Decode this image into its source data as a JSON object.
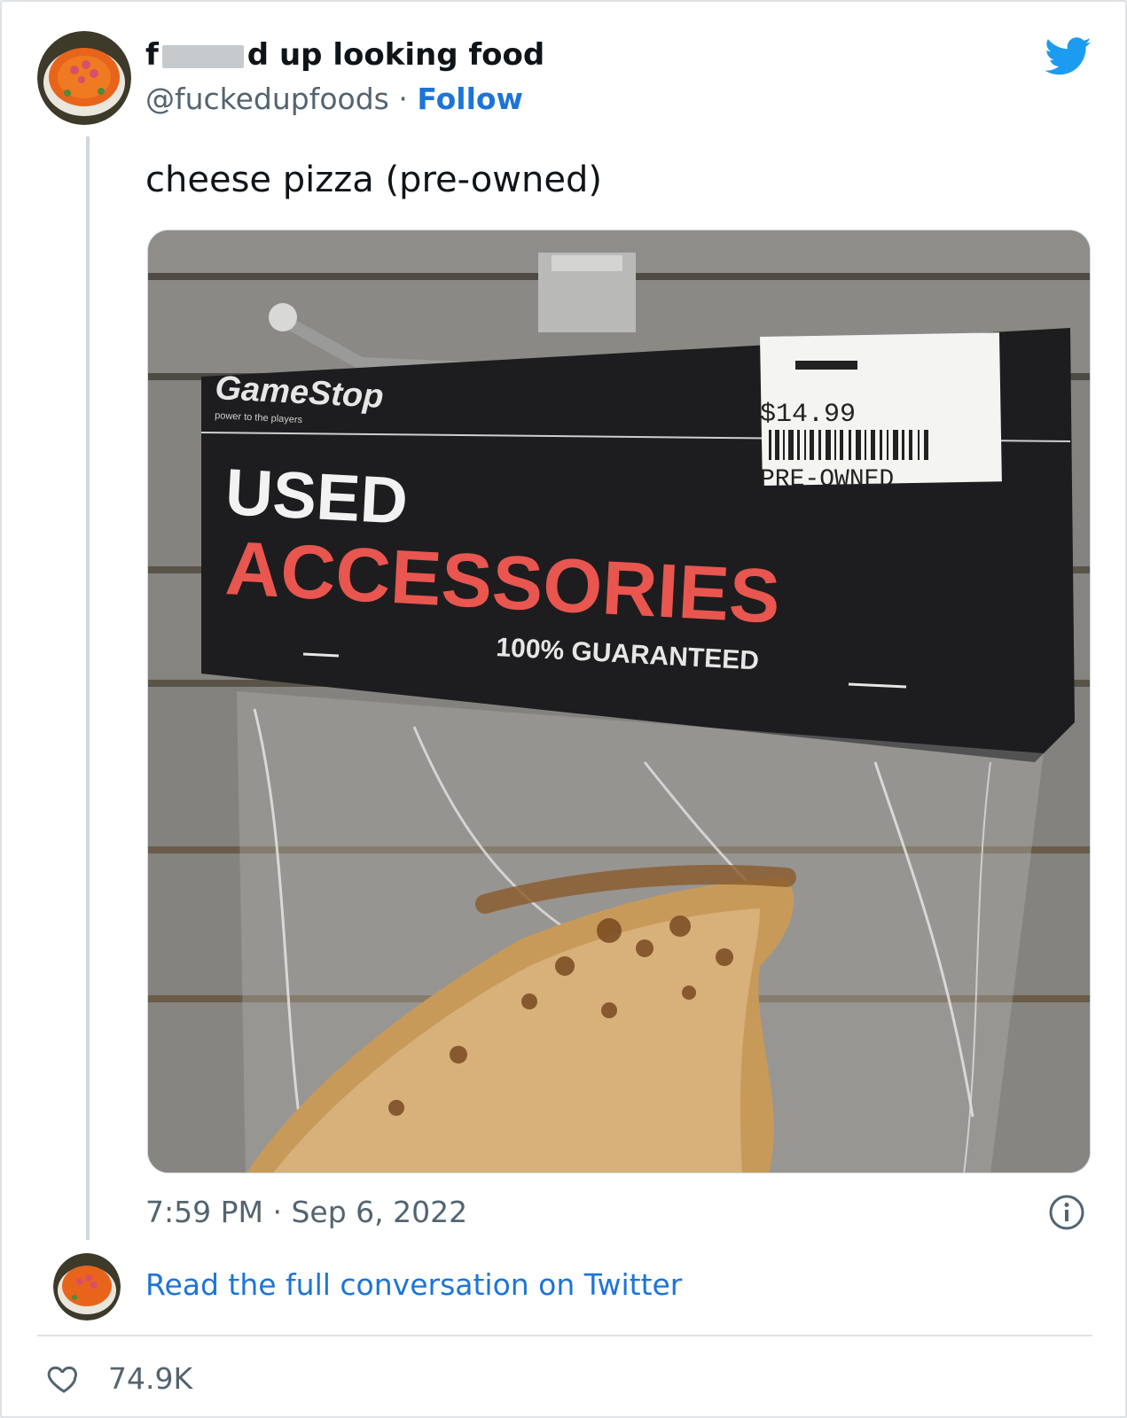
{
  "author": {
    "name_prefix": "f",
    "name_suffix": "d up looking food",
    "handle": "@fuckedupfoods",
    "separator": "·",
    "follow_label": "Follow",
    "avatar_icon": "pizza-avatar-icon"
  },
  "tweet": {
    "text": "cheese pizza (pre-owned)",
    "time": "7:59 PM",
    "separator": "·",
    "date": "Sep 6, 2022"
  },
  "photo": {
    "brand": "GameStop",
    "tagline": "power to the players",
    "heading_line1": "USED",
    "heading_line2": "ACCESSORIES",
    "guarantee": "100% GUARANTEED",
    "price": "$14.99",
    "condition": "PRE-OWNED"
  },
  "footer": {
    "read_conversation": "Read the full conversation on Twitter",
    "like_count": "74.9K"
  },
  "colors": {
    "link_blue": "#1d74d8",
    "twitter_blue": "#1d9bf0",
    "meta_gray": "#536471",
    "sign_red": "#e8564f"
  }
}
